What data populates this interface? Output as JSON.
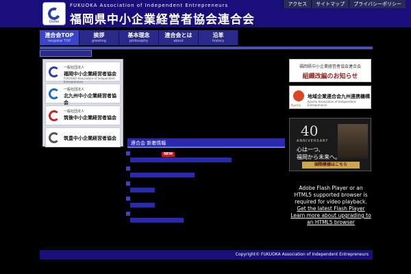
{
  "header": {
    "logo_caption": "Oufes",
    "site_name_en": "FUKUOKA Association of Independent Entrepreneurs",
    "site_name_jp": "福岡県中小企業経営者協会連合会"
  },
  "utility_links": [
    "アクセス",
    "サイトマップ",
    "プライバシーポリシー"
  ],
  "nav": [
    {
      "jp": "連合会TOP",
      "en": "rengokai TOP"
    },
    {
      "jp": "挨拶",
      "en": "greeting"
    },
    {
      "jp": "基本理念",
      "en": "philosophy"
    },
    {
      "jp": "連合会とは",
      "en": "about"
    },
    {
      "jp": "沿革",
      "en": "history"
    }
  ],
  "associations": [
    {
      "small": "一般社団法人",
      "name": "福岡中小企業経営者協会",
      "sub": "FUKUOKA Association of Independent Entrepreneurs"
    },
    {
      "small": "一般社団法人",
      "name": "北九州中小企業経営者協会",
      "sub": ""
    },
    {
      "small": "一般社団法人",
      "name": "筑後中小企業経営者協会",
      "sub": ""
    },
    {
      "small": "",
      "name": "筑豊中小企業経営者協会",
      "sub": ""
    }
  ],
  "news": {
    "heading": "連合会 新着情報",
    "new_badge": "NEW"
  },
  "banners": {
    "notice_line1": "福岡県中小企業経営者協会連合会",
    "notice_line2": "組織改編のお知らせ",
    "kyushu_caption": "Kyushu",
    "kyushu_title": "地域企業連合会九州連携機構",
    "kyushu_sub": "Kyushu Association of Independent Entrepreneurs",
    "anniv_number": "40",
    "anniv_label": "ANNIVERSARY",
    "anniv_slogan1": "心は一つ、",
    "anniv_slogan2": "福岡から未来へ。",
    "anniv_button": "国際模様はこちら"
  },
  "flash": {
    "line1": "Adobe Flash Player or an HTML5 supported browser is required for video playback.",
    "link1": "Get the latest Flash Player",
    "link2": "Learn more about upgrading to an HTML5 browser"
  },
  "footer": {
    "copyright": "Copyright© FUKUOKA Association of Independent Entrepreneurs"
  }
}
